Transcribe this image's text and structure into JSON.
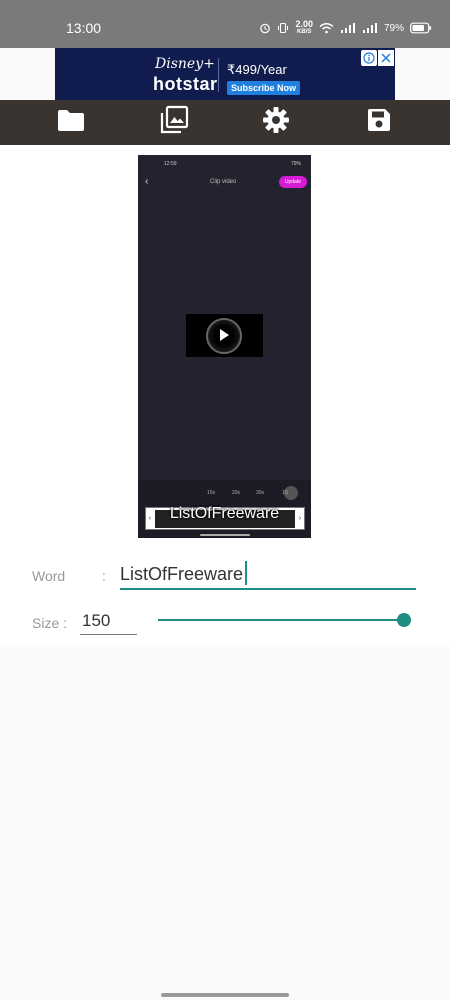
{
  "status_bar": {
    "time": "13:00",
    "net_speed": "2.00",
    "net_unit": "KB/S",
    "battery": "79%",
    "icons": [
      "alarm-icon",
      "vibrate-icon",
      "wifi-icon",
      "signal-icon",
      "signal-icon",
      "battery-icon"
    ]
  },
  "ad": {
    "brand_line1": "Disney+",
    "brand_line2": "hotstar",
    "price": "₹499/Year",
    "cta": "Subscribe Now",
    "adchoice_icon": "info-icon",
    "close_icon": "close-icon"
  },
  "toolbar": {
    "icons": [
      "folder-icon",
      "gallery-icon",
      "gear-icon",
      "save-icon"
    ],
    "background": "#3a3431"
  },
  "preview": {
    "status_time": "12:59",
    "status_right": "79%",
    "header_title": "Clip video",
    "header_button": "Update",
    "timeline_ticks": [
      "10s",
      "20s",
      "30s",
      "1S"
    ],
    "overlay_text": "ListOfFreeware"
  },
  "form": {
    "word_label": "Word",
    "word_colon": ":",
    "word_value": "ListOfFreeware",
    "size_label": "Size :",
    "size_value": "150",
    "slider_fraction": 1.0,
    "accent": "#1e8e83"
  }
}
